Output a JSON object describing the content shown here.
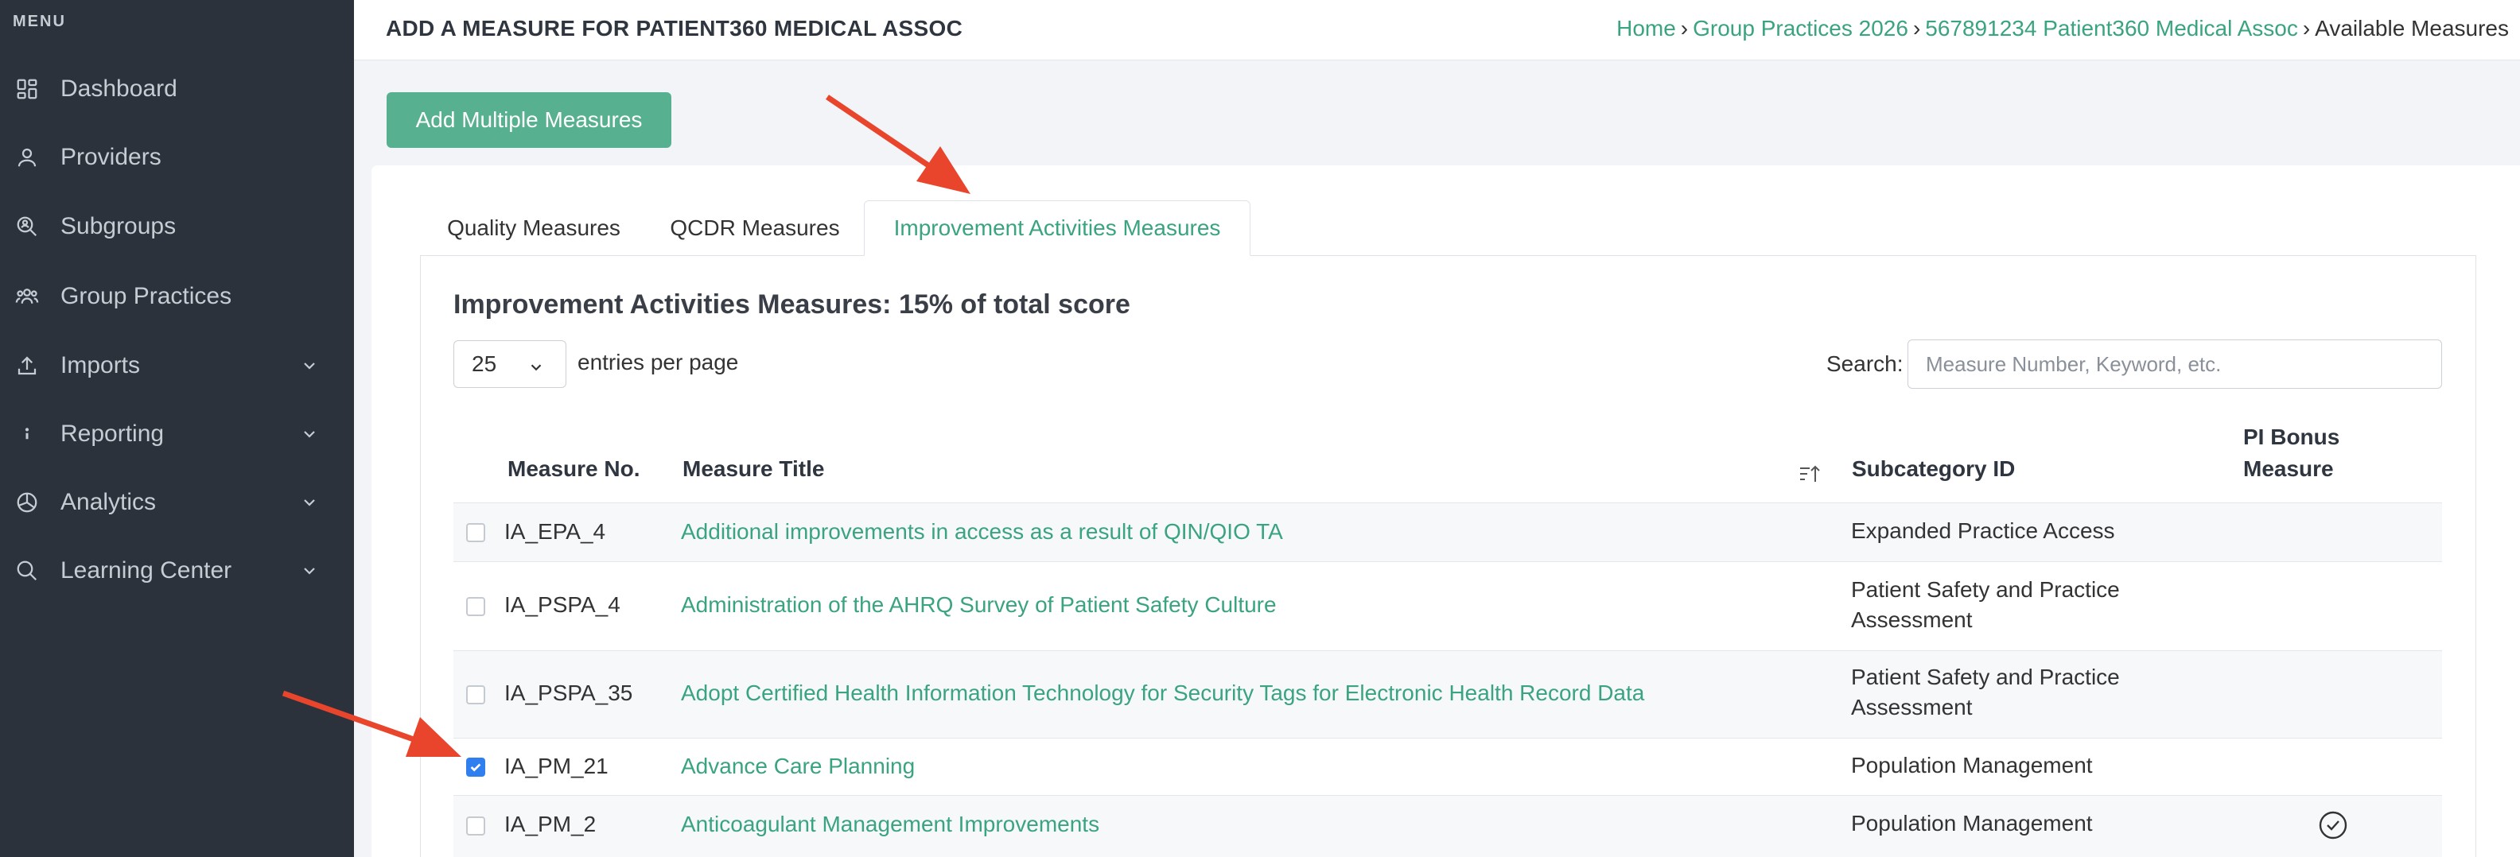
{
  "sidebar": {
    "menu_label": "MENU",
    "items": [
      {
        "label": "Dashboard",
        "icon": "dashboard-icon",
        "expandable": false
      },
      {
        "label": "Providers",
        "icon": "user-icon",
        "expandable": false
      },
      {
        "label": "Subgroups",
        "icon": "search-people-icon",
        "expandable": false
      },
      {
        "label": "Group Practices",
        "icon": "group-icon",
        "expandable": false
      },
      {
        "label": "Imports",
        "icon": "upload-icon",
        "expandable": true
      },
      {
        "label": "Reporting",
        "icon": "info-icon",
        "expandable": true
      },
      {
        "label": "Analytics",
        "icon": "pie-chart-icon",
        "expandable": true
      },
      {
        "label": "Learning Center",
        "icon": "search-icon",
        "expandable": true
      }
    ]
  },
  "header": {
    "title": "ADD A MEASURE FOR PATIENT360 MEDICAL ASSOC",
    "breadcrumb": {
      "home": "Home",
      "group_practices": "Group Practices 2026",
      "practice": "567891234 Patient360 Medical Assoc",
      "current": "Available Measures",
      "separator": "›"
    }
  },
  "actions": {
    "add_multiple": "Add Multiple Measures"
  },
  "tabs": [
    {
      "label": "Quality Measures",
      "active": false
    },
    {
      "label": "QCDR Measures",
      "active": false
    },
    {
      "label": "Improvement Activities Measures",
      "active": true
    }
  ],
  "section": {
    "title": "Improvement Activities Measures: 15% of total score"
  },
  "controls": {
    "entries_value": "25",
    "entries_label": "entries per page",
    "search_label": "Search:",
    "search_placeholder": "Measure Number, Keyword, etc."
  },
  "table": {
    "headers": {
      "measure_no": "Measure No.",
      "measure_title": "Measure Title",
      "subcategory": "Subcategory ID",
      "pi_bonus_line1": "PI Bonus",
      "pi_bonus_line2": "Measure"
    },
    "rows": [
      {
        "checked": false,
        "no": "IA_EPA_4",
        "title": "Additional improvements in access as a result of QIN/QIO TA",
        "sub1": "Expanded Practice Access",
        "sub2": "",
        "bonus": false
      },
      {
        "checked": false,
        "no": "IA_PSPA_4",
        "title": "Administration of the AHRQ Survey of Patient Safety Culture",
        "sub1": "Patient Safety and Practice",
        "sub2": "Assessment",
        "bonus": false
      },
      {
        "checked": false,
        "no": "IA_PSPA_35",
        "title": "Adopt Certified Health Information Technology for Security Tags for Electronic Health Record Data",
        "sub1": "Patient Safety and Practice",
        "sub2": "Assessment",
        "bonus": false
      },
      {
        "checked": true,
        "no": "IA_PM_21",
        "title": "Advance Care Planning",
        "sub1": "Population Management",
        "sub2": "",
        "bonus": false
      },
      {
        "checked": false,
        "no": "IA_PM_2",
        "title": "Anticoagulant Management Improvements",
        "sub1": "Population Management",
        "sub2": "",
        "bonus": true
      }
    ]
  },
  "colors": {
    "accent": "#3aa37f",
    "button": "#57b08f",
    "sidebar": "#2b323c",
    "annotation_arrow": "#e8452c",
    "checkbox_checked": "#2f7ff0"
  }
}
